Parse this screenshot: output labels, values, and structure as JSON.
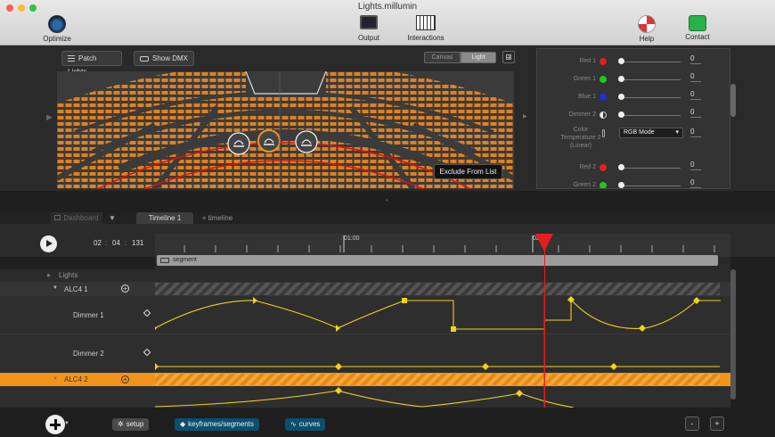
{
  "window": {
    "title": "Lights.millumin"
  },
  "toolbar": {
    "optimize": "Optimize",
    "output": "Output",
    "interactions": "Interactions",
    "help": "Help",
    "contact": "Contact"
  },
  "canvas_bar": {
    "patch_lights": "Patch Lights",
    "show_dmx": "Show DMX",
    "canvas": "Canvas",
    "light": "Light",
    "exclude_tooltip": "Exclude From List"
  },
  "properties": [
    {
      "label": "Red 1",
      "color": "#e02020",
      "value": "0"
    },
    {
      "label": "Green 1",
      "color": "#1ec81e",
      "value": "0"
    },
    {
      "label": "Blue 1",
      "color": "#1a2fe0",
      "value": "0"
    },
    {
      "label": "Dimmer 2",
      "color": "half",
      "value": "0"
    },
    {
      "label": "Color Temperature 2 (Linear)",
      "select": "RGB Mode",
      "value": "0"
    },
    {
      "label": "Red 2",
      "color": "#e02020",
      "value": "0"
    },
    {
      "label": "Green 2",
      "color": "#1ec81e",
      "value": "0"
    }
  ],
  "tabs": {
    "dashboard": "Dashboard",
    "timeline1": "Timeline 1",
    "add": "+ timeline"
  },
  "timecode": {
    "min": "02",
    "sec": "04",
    "frames": "131",
    "ruler_marks": [
      "01:00",
      "02:"
    ]
  },
  "segment": {
    "label": "segment"
  },
  "tracks": {
    "header": "Lights",
    "group1": "ALC4  1",
    "dimmer1": "Dimmer 1",
    "dimmer2": "Dimmer 2",
    "group2": "ALC4  2"
  },
  "bottom": {
    "setup": "setup",
    "keyframes": "keyframes/segments",
    "curves": "curves",
    "minus": "-",
    "plus": "+"
  },
  "colors": {
    "accent": "#f2941a",
    "playhead": "#e81c1c",
    "curve": "#f0d21a",
    "keyframe_chip": "#0b4f6e"
  }
}
